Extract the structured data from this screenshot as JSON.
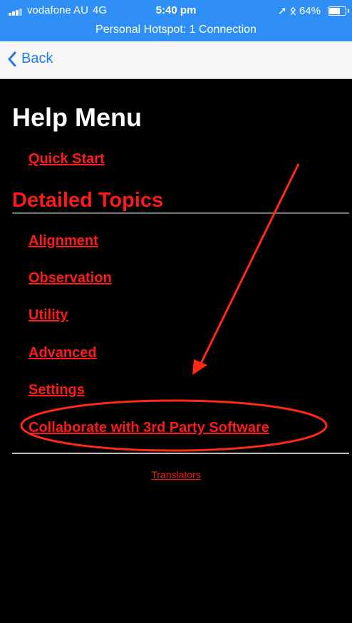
{
  "status_bar": {
    "carrier": "vodafone AU",
    "network": "4G",
    "time": "5:40 pm",
    "battery": "64%",
    "battery_level": 0.64,
    "hotspot": "Personal Hotspot: 1 Connection"
  },
  "nav": {
    "back_label": "Back"
  },
  "help": {
    "title": "Help Menu",
    "quick_start": "Quick Start",
    "section_title": "Detailed Topics",
    "topics": [
      "Alignment",
      "Observation",
      "Utility",
      "Advanced",
      "Settings",
      "Collaborate with 3rd Party Software"
    ],
    "translators": "Translators"
  },
  "colors": {
    "status_bg": "#2f8ff4",
    "link_red": "#ff1a1a",
    "annotation_red": "#ff2a12",
    "ios_blue": "#1a7cf0"
  },
  "icons": {
    "back": "chevron-left-icon",
    "signal": "signal-bars-icon",
    "location": "location-arrow-icon",
    "bluetooth": "bluetooth-icon",
    "battery": "battery-icon"
  }
}
